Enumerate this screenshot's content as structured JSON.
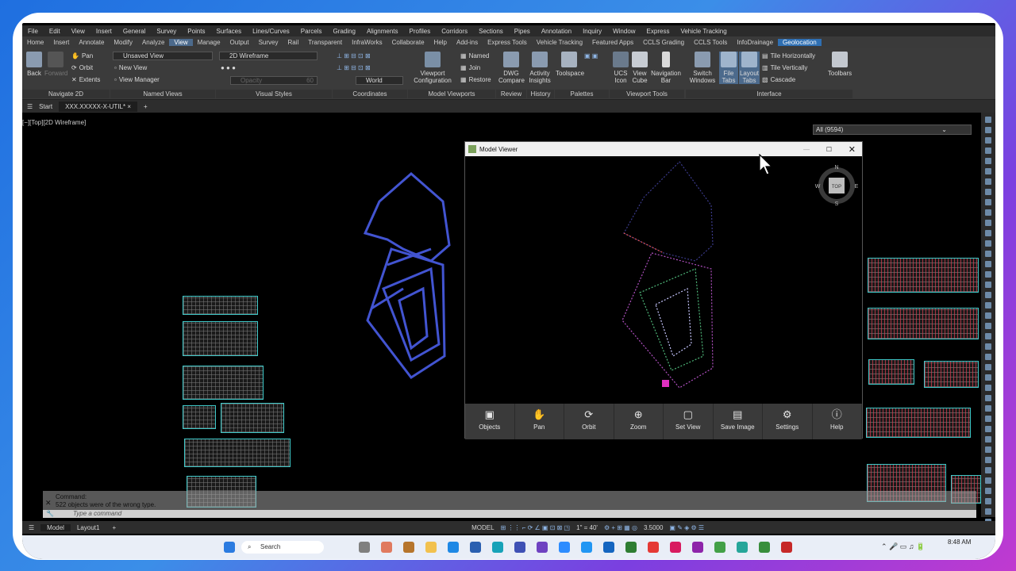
{
  "menubar": [
    "File",
    "Edit",
    "View",
    "Insert",
    "General",
    "Survey",
    "Points",
    "Surfaces",
    "Lines/Curves",
    "Parcels",
    "Grading",
    "Alignments",
    "Profiles",
    "Corridors",
    "Sections",
    "Pipes",
    "Annotation",
    "Inquiry",
    "Window",
    "Express",
    "Vehicle Tracking"
  ],
  "ribbon_tabs": [
    "Home",
    "Insert",
    "Annotate",
    "Modify",
    "Analyze",
    "View",
    "Manage",
    "Output",
    "Survey",
    "Rail",
    "Transparent",
    "InfraWorks",
    "Collaborate",
    "Help",
    "Add-ins",
    "Express Tools",
    "Vehicle Tracking",
    "Featured Apps",
    "CCLS Grading",
    "CCLS Tools",
    "InfoDrainage",
    "Geolocation"
  ],
  "ribbon": {
    "back": "Back",
    "forward": "Forward",
    "pan": "Pan",
    "orbit": "Orbit",
    "extents": "Extents",
    "navigate_panel": "Navigate 2D",
    "unsaved_view": "Unsaved View",
    "new_view": "New View",
    "view_manager": "View Manager",
    "named_views_panel": "Named Views",
    "visual_style": "2D Wireframe",
    "opacity": "Opacity",
    "opacity_val": "60",
    "visual_styles_panel": "Visual Styles",
    "world": "World",
    "coordinates_panel": "Coordinates",
    "viewport_config": "Viewport Configuration",
    "named": "Named",
    "join": "Join",
    "restore": "Restore",
    "model_viewports_panel": "Model Viewports",
    "dwg_compare": "DWG Compare",
    "review_panel": "Review",
    "activity_insights": "Activity Insights",
    "history_panel": "History",
    "toolspace": "Toolspace",
    "palettes_panel": "Palettes",
    "ucs_icon": "UCS Icon",
    "view_cube": "View Cube",
    "navigation_bar": "Navigation Bar",
    "viewport_tools_panel": "Viewport Tools",
    "switch_windows": "Switch Windows",
    "file_tabs": "File Tabs",
    "layout_tabs": "Layout Tabs",
    "tile_h": "Tile Horizontally",
    "tile_v": "Tile Vertically",
    "cascade": "Cascade",
    "interface_panel": "Interface",
    "toolbars": "Toolbars"
  },
  "doctabs": {
    "start": "Start",
    "file": "XXX.XXXXX-X-UTIL*"
  },
  "viewport_label": "[−][Top][2D Wireframe]",
  "layer_filter": "All (9594)",
  "viewer": {
    "title": "Model Viewer",
    "compass": {
      "n": "N",
      "s": "S",
      "e": "E",
      "w": "W",
      "cube": "TOP"
    },
    "toolbar": [
      {
        "label": "Objects",
        "glyph": "▣"
      },
      {
        "label": "Pan",
        "glyph": "✋"
      },
      {
        "label": "Orbit",
        "glyph": "⟳"
      },
      {
        "label": "Zoom",
        "glyph": "⊕"
      },
      {
        "label": "Set View",
        "glyph": "▢"
      },
      {
        "label": "Save Image",
        "glyph": "▤"
      },
      {
        "label": "Settings",
        "glyph": "⚙"
      },
      {
        "label": "Help",
        "glyph": "ⓘ"
      }
    ]
  },
  "command": {
    "line1": "Command:",
    "line2": "522 objects were of the wrong type.",
    "placeholder": "Type a command"
  },
  "status": {
    "model_tab": "Model",
    "layout_tab": "Layout1",
    "model_mode": "MODEL",
    "scale": "1\" = 40'",
    "value": "3.5000"
  },
  "taskbar": {
    "search": "Search",
    "time": "8:48 AM"
  },
  "colors": {
    "accent": "#2f6fb2",
    "sheet_border": "#3ec8c8",
    "plan_blue": "#4a5ee8"
  }
}
